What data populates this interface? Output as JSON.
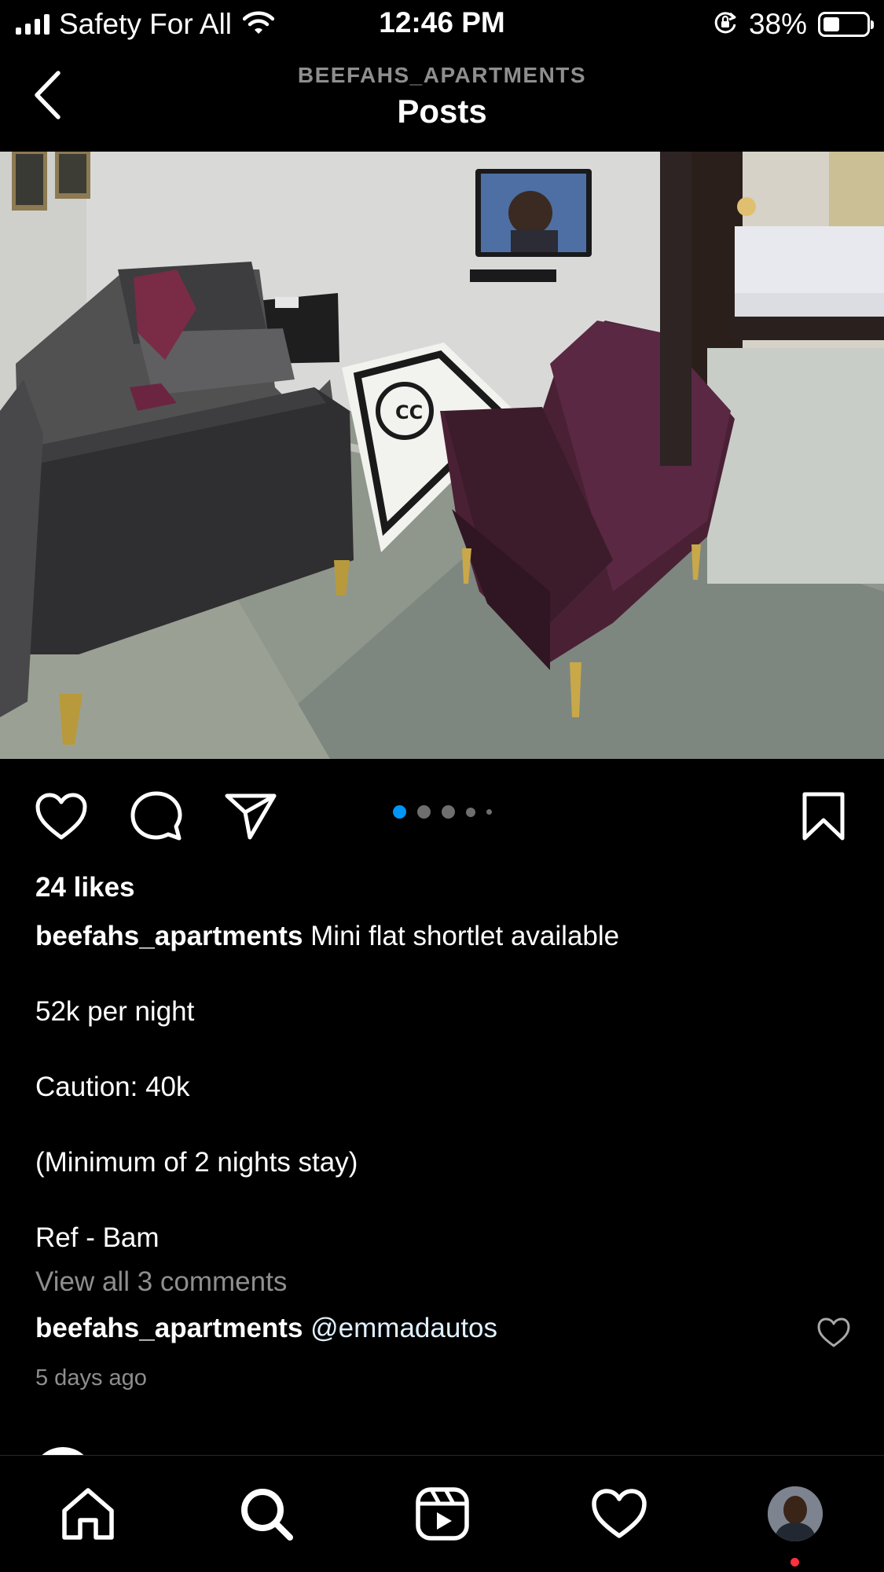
{
  "status_bar": {
    "carrier": "Safety For All",
    "time": "12:46 PM",
    "battery": "38%",
    "battery_level": 0.38
  },
  "header": {
    "account": "BEEFAHS_APARTMENTS",
    "title": "Posts"
  },
  "post": {
    "carousel": {
      "total": 5,
      "active_index": 0
    },
    "likes": "24 likes",
    "username": "beefahs_apartments",
    "caption_lines": [
      "Mini flat shortlet available",
      "52k per night",
      "Caution: 40k",
      "(Minimum of 2 nights stay)",
      "Ref - Bam"
    ],
    "view_comments": "View all 3 comments",
    "comment": {
      "username": "beefahs_apartments",
      "text": "@emmadautos"
    },
    "timestamp": "5 days ago"
  },
  "colors": {
    "background": "#000000",
    "text": "#ffffff",
    "muted": "#8e8e8e",
    "active_dot": "#0095f6",
    "notification": "#ff3040"
  },
  "icons": {
    "back": "chevron-left-icon",
    "like": "heart-icon",
    "comment": "comment-bubble-icon",
    "share": "paper-plane-icon",
    "save": "bookmark-icon",
    "home": "home-icon",
    "search": "search-icon",
    "reels": "reels-icon",
    "activity": "heart-icon",
    "profile": "avatar"
  }
}
